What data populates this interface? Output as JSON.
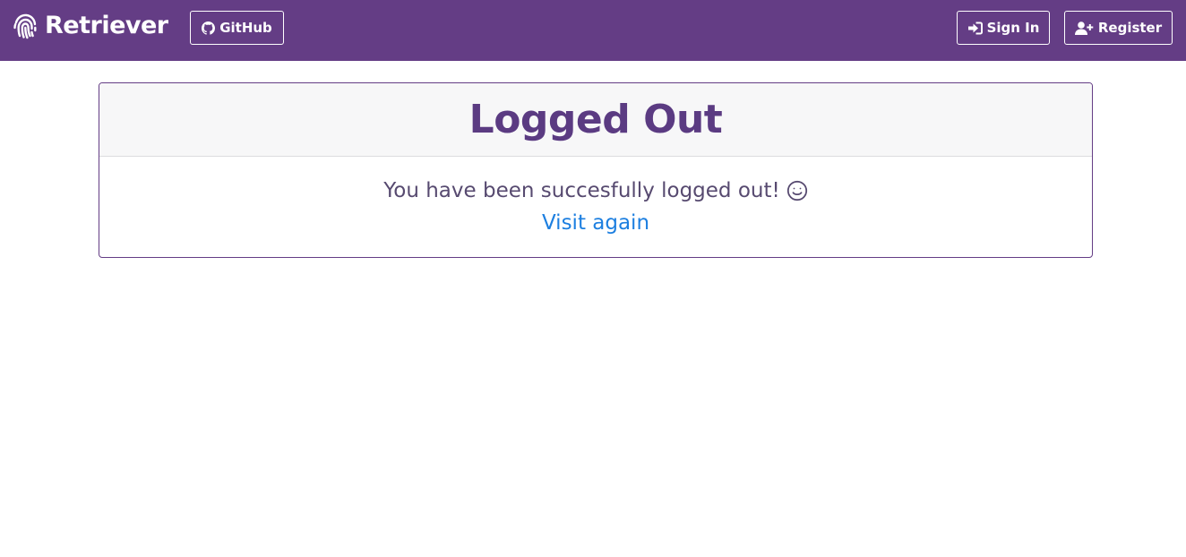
{
  "navbar": {
    "brand": "Retriever",
    "brand_icon": "fingerprint-icon",
    "github_label": "GitHub",
    "github_icon": "github-icon",
    "signin_label": "Sign In",
    "signin_icon": "sign-in-icon",
    "register_label": "Register",
    "register_icon": "user-plus-icon",
    "background_color": "#643d85"
  },
  "card": {
    "title": "Logged Out",
    "message": "You have been succesfully logged out!",
    "message_icon": "smiley-icon",
    "link_label": "Visit again",
    "title_color": "#5b3b82",
    "link_color": "#1d7fe0"
  }
}
